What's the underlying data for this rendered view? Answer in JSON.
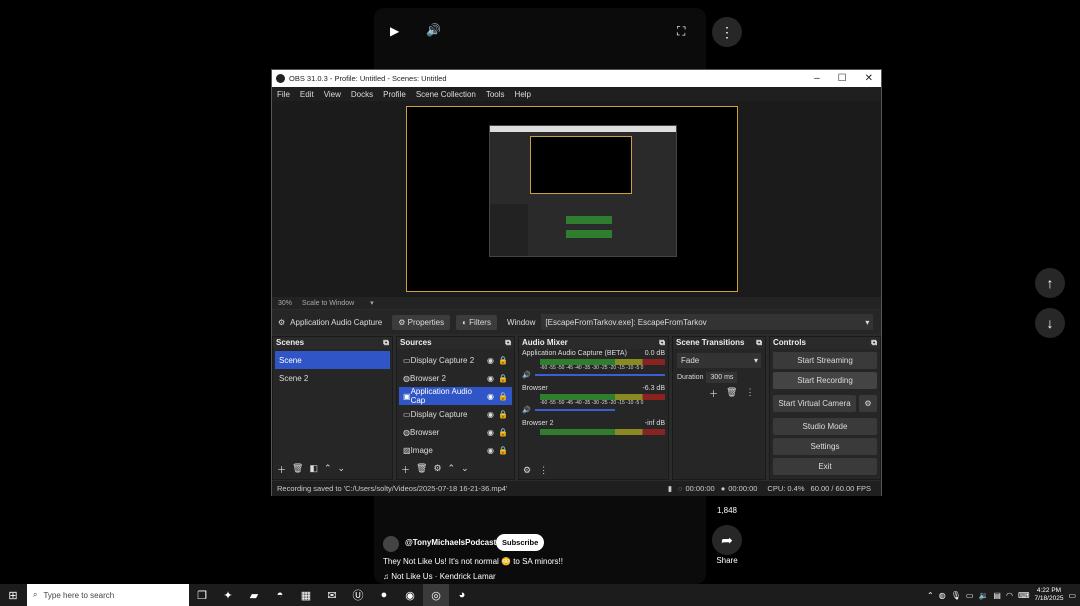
{
  "shorts": {
    "like_count": "1,848",
    "share_label": "Share",
    "channel": "@TonyMichaelsPodcast",
    "subscribe_label": "Subscribe",
    "caption": "They Not Like Us! It's not normal 😳 to SA minors!!",
    "song": "Not Like Us · Kendrick Lamar"
  },
  "obs": {
    "title": "OBS 31.0.3 - Profile: Untitled - Scenes: Untitled",
    "menu": [
      "File",
      "Edit",
      "View",
      "Docks",
      "Profile",
      "Scene Collection",
      "Tools",
      "Help"
    ],
    "zoom": "30%",
    "zoom_mode": "Scale to Window",
    "source_bar": {
      "selected_source": "Application Audio Capture",
      "properties_label": "Properties",
      "filters_label": "Filters",
      "window_label": "Window",
      "window_value": "[EscapeFromTarkov.exe]: EscapeFromTarkov"
    },
    "scenes": {
      "title": "Scenes",
      "items": [
        "Scene",
        "Scene 2"
      ]
    },
    "sources": {
      "title": "Sources",
      "items": [
        "Display Capture 2",
        "Browser 2",
        "Application Audio Cap",
        "Display Capture",
        "Browser",
        "Image"
      ]
    },
    "mixer": {
      "title": "Audio Mixer",
      "channels": [
        {
          "name": "Application Audio Capture (BETA)",
          "db": "0.0 dB"
        },
        {
          "name": "Browser",
          "db": "-6.3 dB"
        },
        {
          "name": "Browser 2",
          "db": "-inf dB"
        }
      ],
      "scale": "-60 -55 -50 -45 -40 -35 -30 -25 -20 -15 -10 -5 0"
    },
    "transitions": {
      "title": "Scene Transitions",
      "type": "Fade",
      "duration_label": "Duration",
      "duration_value": "300 ms"
    },
    "controls": {
      "title": "Controls",
      "start_streaming": "Start Streaming",
      "start_recording": "Start Recording",
      "start_virtual_camera": "Start Virtual Camera",
      "studio_mode": "Studio Mode",
      "settings": "Settings",
      "exit": "Exit"
    },
    "status": {
      "message": "Recording saved to 'C:/Users/solty/Videos/2025-07-18 16-21-36.mp4'",
      "stream_time": "00:00:00",
      "rec_time": "00:00:00",
      "cpu": "CPU: 0.4%",
      "fps": "60.00 / 60.00 FPS"
    }
  },
  "taskbar": {
    "search_placeholder": "Type here to search",
    "time": "4:22 PM",
    "date": "7/18/2025"
  }
}
